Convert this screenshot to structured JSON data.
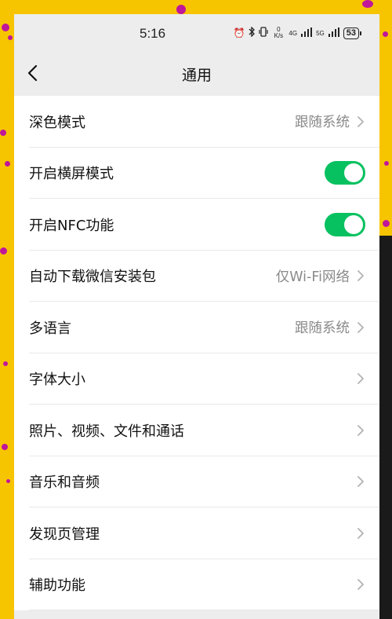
{
  "status_bar": {
    "time": "5:16",
    "net_speed": "0 K/s",
    "signal_1": "4G",
    "signal_2": "5G",
    "battery": "53"
  },
  "nav": {
    "title": "通用"
  },
  "settings": [
    {
      "label": "深色模式",
      "value": "跟随系统",
      "control": "chevron"
    },
    {
      "label": "开启横屏模式",
      "value": "",
      "control": "toggle",
      "on": true
    },
    {
      "label": "开启NFC功能",
      "value": "",
      "control": "toggle",
      "on": true
    },
    {
      "label": "自动下载微信安装包",
      "value": "仅Wi-Fi网络",
      "control": "chevron"
    },
    {
      "label": "多语言",
      "value": "跟随系统",
      "control": "chevron"
    },
    {
      "label": "字体大小",
      "value": "",
      "control": "chevron"
    },
    {
      "label": "照片、视频、文件和通话",
      "value": "",
      "control": "chevron"
    },
    {
      "label": "音乐和音频",
      "value": "",
      "control": "chevron"
    },
    {
      "label": "发现页管理",
      "value": "",
      "control": "chevron"
    },
    {
      "label": "辅助功能",
      "value": "",
      "control": "chevron"
    }
  ],
  "colors": {
    "toggle_on": "#07c160",
    "background_yellow": "#f7c400",
    "dot_magenta": "#c0169a"
  }
}
